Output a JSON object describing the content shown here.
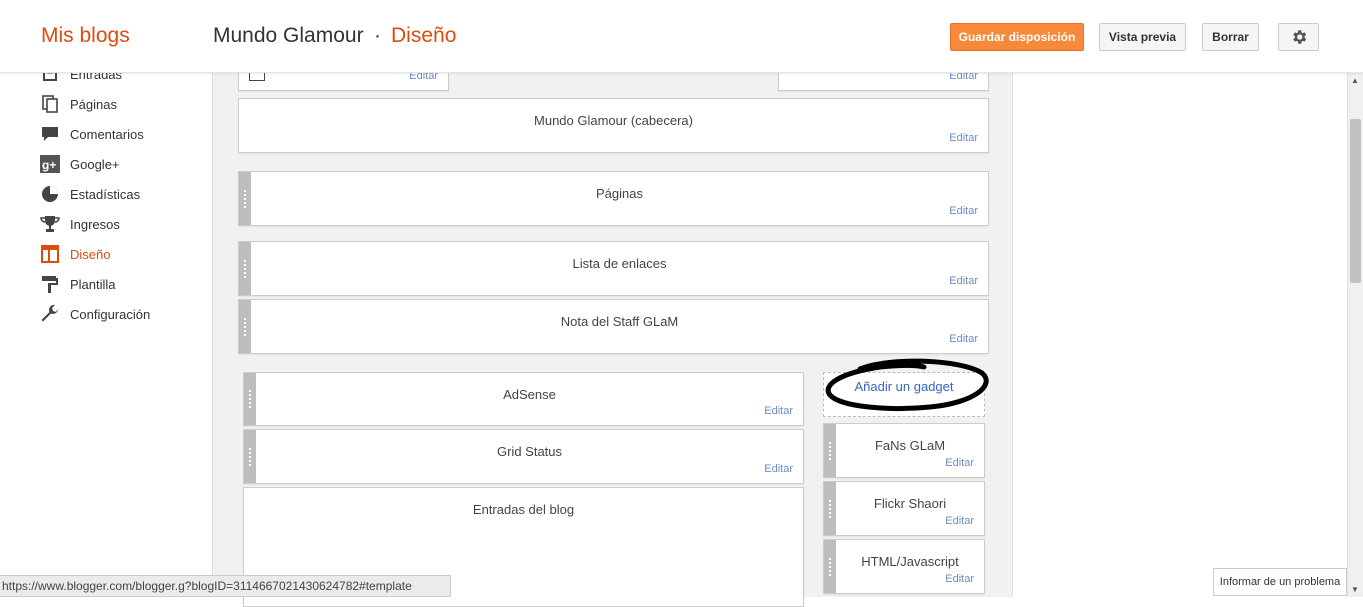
{
  "header": {
    "brand": "Mis blogs",
    "blog_name": "Mundo Glamour",
    "separator": "·",
    "section": "Diseño",
    "buttons": {
      "save": "Guardar disposición",
      "preview": "Vista previa",
      "clear": "Borrar",
      "settings_icon": "gear-icon"
    }
  },
  "nav": {
    "items": [
      {
        "label": "Entradas",
        "icon": "posts-icon"
      },
      {
        "label": "Páginas",
        "icon": "pages-icon"
      },
      {
        "label": "Comentarios",
        "icon": "comments-icon"
      },
      {
        "label": "Google+",
        "icon": "google-plus-icon"
      },
      {
        "label": "Estadísticas",
        "icon": "stats-icon"
      },
      {
        "label": "Ingresos",
        "icon": "trophy-icon"
      },
      {
        "label": "Diseño",
        "icon": "layout-icon",
        "active": true
      },
      {
        "label": "Plantilla",
        "icon": "template-icon"
      },
      {
        "label": "Configuración",
        "icon": "wrench-icon"
      }
    ]
  },
  "layout": {
    "edit_label": "Editar",
    "gadgets": {
      "header": "Mundo Glamour (cabecera)",
      "pages": "Páginas",
      "link_list": "Lista de enlaces",
      "staff_note": "Nota del Staff GLaM",
      "adsense": "AdSense",
      "grid_status": "Grid Status",
      "blog_posts": "Entradas del blog",
      "fans": "FaNs GLaM",
      "flickr": "Flickr Shaori",
      "html_js": "HTML/Javascript"
    },
    "add_gadget": "Añadir un gadget"
  },
  "status_bar": {
    "url": "https://www.blogger.com/blogger.g?blogID=3114667021430624782#template"
  },
  "report_problem": "Informar de un problema",
  "colors": {
    "accent": "#dd4b10",
    "save_button": "#f6893a",
    "link": "#3a66c2"
  }
}
